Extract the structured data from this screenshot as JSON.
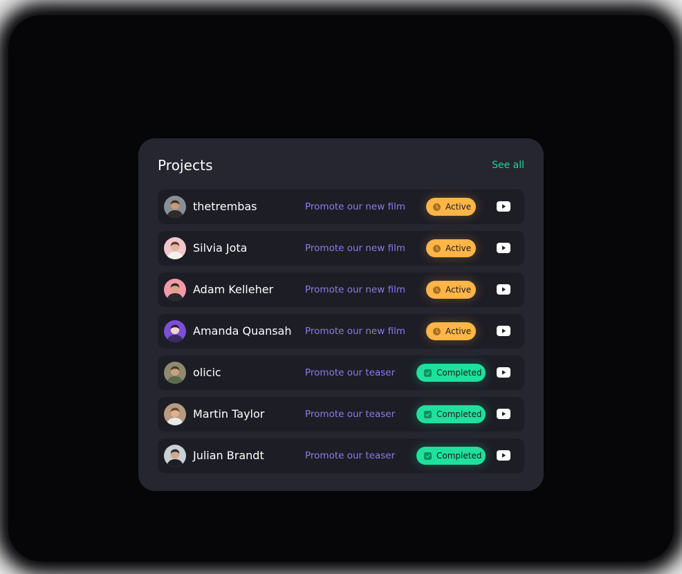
{
  "panel": {
    "title": "Projects",
    "see_all_label": "See all"
  },
  "projects": [
    {
      "name": "thetrembas",
      "project": "Promote our new film",
      "status": "Active",
      "status_type": "active",
      "avatar_bg": "#8a8f93",
      "avatar_skin": "#c89a7a",
      "avatar_hair": "#3a2f2a",
      "avatar_shirt": "#2c2c2c"
    },
    {
      "name": "Silvia Jota",
      "project": "Promote our new film",
      "status": "Active",
      "status_type": "active",
      "avatar_bg": "#f0c7cf",
      "avatar_skin": "#e2b69a",
      "avatar_hair": "#5a3a2a",
      "avatar_shirt": "#f4f0ea"
    },
    {
      "name": "Adam Kelleher",
      "project": "Promote our new film",
      "status": "Active",
      "status_type": "active",
      "avatar_bg": "#f29aa6",
      "avatar_skin": "#d8a585",
      "avatar_hair": "#2e2520",
      "avatar_shirt": "#2a2a30"
    },
    {
      "name": "Amanda Quansah",
      "project": "Promote our new film",
      "status": "Active",
      "status_type": "active",
      "avatar_bg": "#7b4fd6",
      "avatar_skin": "#f3d5c3",
      "avatar_hair": "#2a1e3c",
      "avatar_shirt": "#3a2b62"
    },
    {
      "name": "olicic",
      "project": "Promote our teaser",
      "status": "Completed",
      "status_type": "completed",
      "avatar_bg": "#8e8a70",
      "avatar_skin": "#caa07e",
      "avatar_hair": "#4a3b2a",
      "avatar_shirt": "#5a6a4a"
    },
    {
      "name": "Martin Taylor",
      "project": "Promote our teaser",
      "status": "Completed",
      "status_type": "completed",
      "avatar_bg": "#b79a80",
      "avatar_skin": "#e0b28c",
      "avatar_hair": "#6a4a30",
      "avatar_shirt": "#e8e8e8"
    },
    {
      "name": "Julian Brandt",
      "project": "Promote our teaser",
      "status": "Completed",
      "status_type": "completed",
      "avatar_bg": "#c7d1d6",
      "avatar_skin": "#d3a789",
      "avatar_hair": "#2a2a2a",
      "avatar_shirt": "#1e1e24"
    }
  ],
  "icons": {
    "active_status": "clock-icon",
    "completed_status": "check-icon",
    "row_action": "youtube-play-icon"
  },
  "colors": {
    "card_bg": "#262630",
    "row_bg": "#1d1d26",
    "accent_green": "#1fd59c",
    "active_badge": "#ffb547",
    "completed_badge": "#1fe09c",
    "project_text": "#8b7ce8"
  }
}
